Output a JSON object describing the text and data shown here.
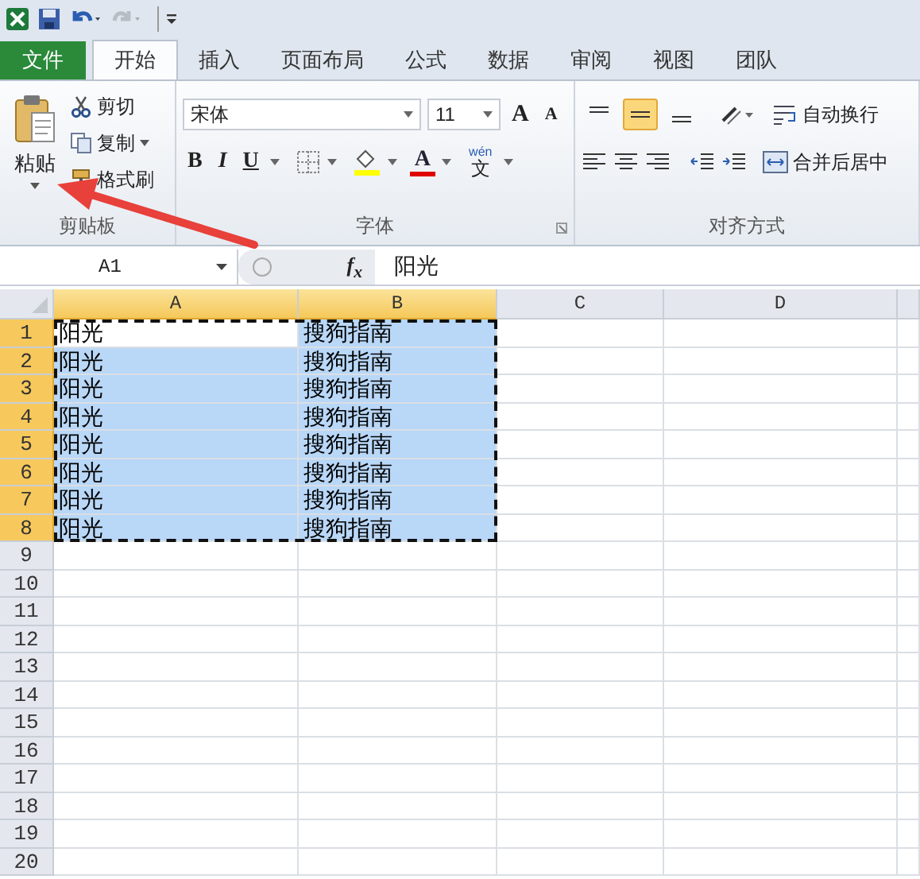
{
  "tabs": [
    {
      "label": "文件",
      "kind": "file",
      "selected": false
    },
    {
      "label": "开始",
      "kind": "tab",
      "selected": true
    },
    {
      "label": "插入",
      "kind": "tab",
      "selected": false
    },
    {
      "label": "页面布局",
      "kind": "tab",
      "selected": false
    },
    {
      "label": "公式",
      "kind": "tab",
      "selected": false
    },
    {
      "label": "数据",
      "kind": "tab",
      "selected": false
    },
    {
      "label": "审阅",
      "kind": "tab",
      "selected": false
    },
    {
      "label": "视图",
      "kind": "tab",
      "selected": false
    },
    {
      "label": "团队",
      "kind": "tab",
      "selected": false
    }
  ],
  "clipboard": {
    "paste": "粘贴",
    "cut": "剪切",
    "copy": "复制",
    "format_painter": "格式刷",
    "group_label": "剪贴板"
  },
  "font": {
    "name": "宋体",
    "size": "11",
    "grow": "A",
    "shrink": "A",
    "bold": "B",
    "italic": "I",
    "underline": "U",
    "font_color": "A",
    "phonetic_top": "wén",
    "phonetic_char": "文",
    "group_label": "字体"
  },
  "alignment": {
    "wrap_text": "自动换行",
    "merge_center": "合并后居中",
    "group_label": "对齐方式",
    "vertical": [
      {
        "kind": "top",
        "selected": false
      },
      {
        "kind": "middle",
        "selected": true
      },
      {
        "kind": "bottom",
        "selected": false
      }
    ]
  },
  "name_box": "A1",
  "formula_label": "f$_{x}$",
  "formula": "阳光",
  "columns": [
    {
      "label": "A",
      "selected": true
    },
    {
      "label": "B",
      "selected": true
    },
    {
      "label": "C",
      "selected": false
    },
    {
      "label": "D",
      "selected": false
    }
  ],
  "rows": [
    {
      "label": "1",
      "selected": true,
      "cells": [
        {
          "text": "阳光",
          "active": true
        },
        {
          "text": "搜狗指南",
          "active": false
        }
      ]
    },
    {
      "label": "2",
      "selected": true,
      "cells": [
        {
          "text": "阳光",
          "active": false
        },
        {
          "text": "搜狗指南",
          "active": false
        }
      ]
    },
    {
      "label": "3",
      "selected": true,
      "cells": [
        {
          "text": "阳光",
          "active": false
        },
        {
          "text": "搜狗指南",
          "active": false
        }
      ]
    },
    {
      "label": "4",
      "selected": true,
      "cells": [
        {
          "text": "阳光",
          "active": false
        },
        {
          "text": "搜狗指南",
          "active": false
        }
      ]
    },
    {
      "label": "5",
      "selected": true,
      "cells": [
        {
          "text": "阳光",
          "active": false
        },
        {
          "text": "搜狗指南",
          "active": false
        }
      ]
    },
    {
      "label": "6",
      "selected": true,
      "cells": [
        {
          "text": "阳光",
          "active": false
        },
        {
          "text": "搜狗指南",
          "active": false
        }
      ]
    },
    {
      "label": "7",
      "selected": true,
      "cells": [
        {
          "text": "阳光",
          "active": false
        },
        {
          "text": "搜狗指南",
          "active": false
        }
      ]
    },
    {
      "label": "8",
      "selected": true,
      "cells": [
        {
          "text": "阳光",
          "active": false
        },
        {
          "text": "搜狗指南",
          "active": false
        }
      ]
    },
    {
      "label": "9",
      "selected": false,
      "cells": []
    },
    {
      "label": "10",
      "selected": false,
      "cells": []
    },
    {
      "label": "11",
      "selected": false,
      "cells": []
    },
    {
      "label": "12",
      "selected": false,
      "cells": []
    },
    {
      "label": "13",
      "selected": false,
      "cells": []
    },
    {
      "label": "14",
      "selected": false,
      "cells": []
    },
    {
      "label": "15",
      "selected": false,
      "cells": []
    },
    {
      "label": "16",
      "selected": false,
      "cells": []
    },
    {
      "label": "17",
      "selected": false,
      "cells": []
    },
    {
      "label": "18",
      "selected": false,
      "cells": []
    },
    {
      "label": "19",
      "selected": false,
      "cells": []
    },
    {
      "label": "20",
      "selected": false,
      "cells": []
    }
  ]
}
